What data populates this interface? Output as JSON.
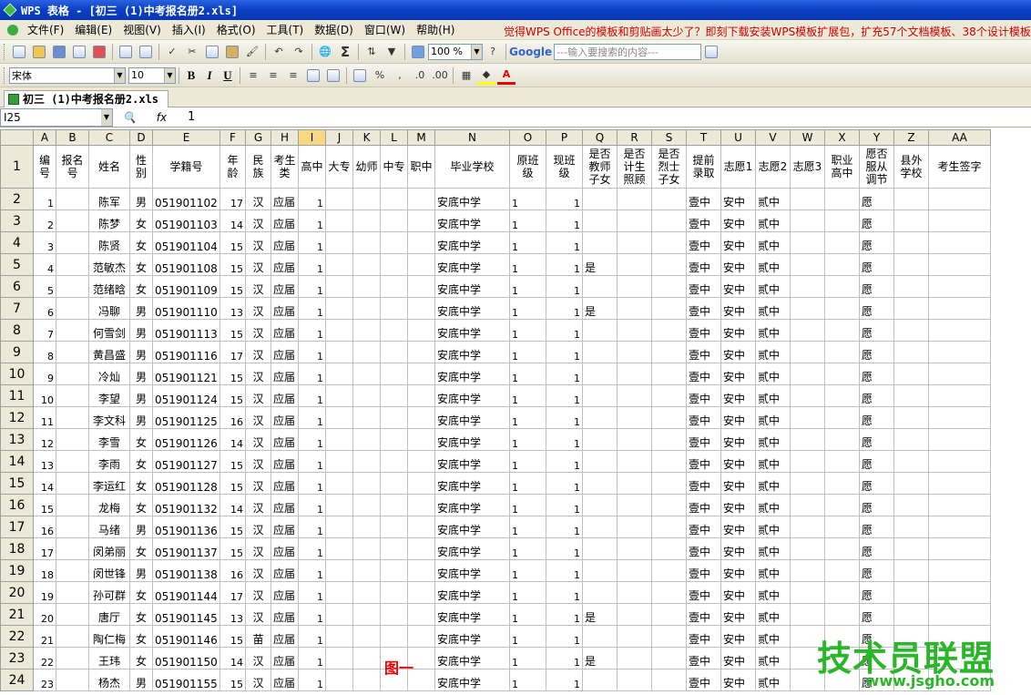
{
  "title": "WPS 表格 - [初三 (1)中考报名册2.xls]",
  "menus": [
    "文件(F)",
    "编辑(E)",
    "视图(V)",
    "插入(I)",
    "格式(O)",
    "工具(T)",
    "数据(D)",
    "窗口(W)",
    "帮助(H)"
  ],
  "ad": "觉得WPS Office的模板和剪贴画太少了？即刻下载安装WPS模板扩展包，扩充57个文档模板、38个设计模板和",
  "zoom": "100 %",
  "search_engine": "Google",
  "search_placeholder": "---输入要搜索的内容---",
  "font_name": "宋体",
  "font_size": "10",
  "tab": "初三 (1)中考报名册2.xls",
  "cell_ref": "I25",
  "formula": "1",
  "cols": [
    "A",
    "B",
    "C",
    "D",
    "E",
    "F",
    "G",
    "H",
    "I",
    "J",
    "K",
    "L",
    "M",
    "N",
    "O",
    "P",
    "Q",
    "R",
    "S",
    "T",
    "U",
    "V",
    "W",
    "X",
    "Y",
    "Z",
    "AA"
  ],
  "headers": [
    "编号",
    "报名号",
    "姓名",
    "性别",
    "学籍号",
    "年龄",
    "民族",
    "考生类",
    "高中",
    "大专",
    "幼师",
    "中专",
    "职中",
    "毕业学校",
    "原班级",
    "现班级",
    "是否教师子女",
    "是否计生照顾",
    "是否烈士子女",
    "提前录取",
    "志愿1",
    "志愿2",
    "志愿3",
    "职业高中",
    "愿否服从调节",
    "县外学校",
    "考生签字"
  ],
  "rows": [
    [
      "1",
      "陈军",
      "男",
      "051901102",
      "17",
      "汉",
      "1",
      ""
    ],
    [
      "2",
      "陈梦",
      "女",
      "051901103",
      "14",
      "汉",
      "1",
      ""
    ],
    [
      "3",
      "陈贤",
      "女",
      "051901104",
      "15",
      "汉",
      "1",
      ""
    ],
    [
      "4",
      "范敏杰",
      "女",
      "051901108",
      "15",
      "汉",
      "1",
      "是"
    ],
    [
      "5",
      "范绪晗",
      "女",
      "051901109",
      "15",
      "汉",
      "1",
      ""
    ],
    [
      "6",
      "冯聊",
      "男",
      "051901110",
      "13",
      "汉",
      "1",
      "是"
    ],
    [
      "7",
      "何雪剑",
      "男",
      "051901113",
      "15",
      "汉",
      "1",
      ""
    ],
    [
      "8",
      "黄昌盛",
      "男",
      "051901116",
      "17",
      "汉",
      "1",
      ""
    ],
    [
      "9",
      "冷灿",
      "男",
      "051901121",
      "15",
      "汉",
      "1",
      ""
    ],
    [
      "10",
      "李望",
      "男",
      "051901124",
      "15",
      "汉",
      "1",
      ""
    ],
    [
      "11",
      "李文科",
      "男",
      "051901125",
      "16",
      "汉",
      "1",
      ""
    ],
    [
      "12",
      "李雪",
      "女",
      "051901126",
      "14",
      "汉",
      "1",
      ""
    ],
    [
      "13",
      "李雨",
      "女",
      "051901127",
      "15",
      "汉",
      "1",
      ""
    ],
    [
      "14",
      "李运红",
      "女",
      "051901128",
      "15",
      "汉",
      "1",
      ""
    ],
    [
      "15",
      "龙梅",
      "女",
      "051901132",
      "14",
      "汉",
      "1",
      ""
    ],
    [
      "16",
      "马绪",
      "男",
      "051901136",
      "15",
      "汉",
      "1",
      ""
    ],
    [
      "17",
      "闵弟丽",
      "女",
      "051901137",
      "15",
      "汉",
      "1",
      ""
    ],
    [
      "18",
      "闵世锋",
      "男",
      "051901138",
      "16",
      "汉",
      "1",
      ""
    ],
    [
      "19",
      "孙可群",
      "女",
      "051901144",
      "17",
      "汉",
      "1",
      ""
    ],
    [
      "20",
      "唐厅",
      "女",
      "051901145",
      "13",
      "汉",
      "1",
      "是"
    ],
    [
      "21",
      "陶仁梅",
      "女",
      "051901146",
      "15",
      "苗",
      "1",
      ""
    ],
    [
      "22",
      "王玮",
      "女",
      "051901150",
      "14",
      "汉",
      "1",
      "是"
    ],
    [
      "23",
      "杨杰",
      "男",
      "051901155",
      "15",
      "汉",
      "1",
      ""
    ]
  ],
  "const": {
    "type": "应届",
    "school": "安底中学",
    "v_early": "壹中",
    "v1": "安中",
    "v2": "贰中",
    "obey": "愿"
  },
  "figure_label": "图一",
  "watermark": "技术员联盟",
  "watermark_url": "www.jsgho.com"
}
